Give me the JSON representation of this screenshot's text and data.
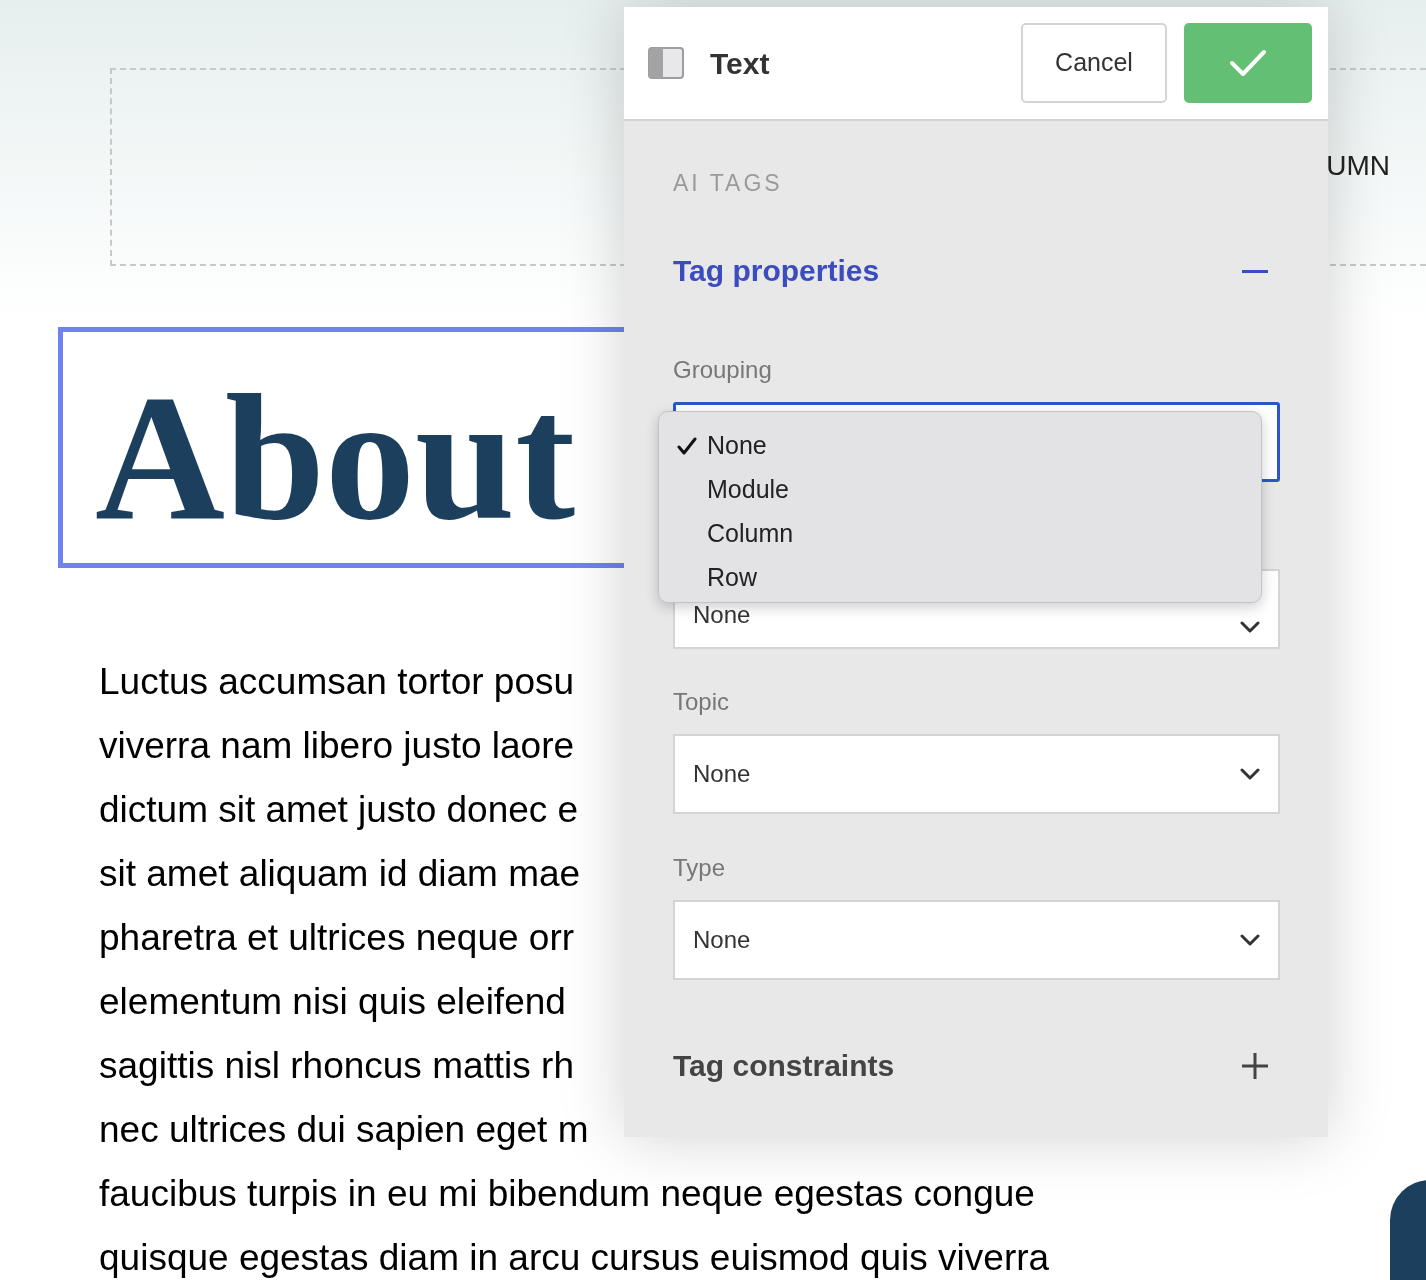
{
  "page": {
    "column_label": "UMN",
    "heading": "About",
    "paragraph_lines": [
      "Luctus accumsan tortor posu",
      "viverra nam libero justo laore",
      "dictum sit amet justo donec e",
      "sit amet aliquam id diam mae",
      "pharetra et ultrices neque orr",
      "elementum nisi quis eleifend",
      "sagittis nisl rhoncus mattis rh",
      "nec ultrices dui sapien eget m",
      "faucibus turpis in eu mi bibendum neque egestas congue",
      "quisque egestas diam in arcu cursus euismod quis viverra"
    ]
  },
  "panel": {
    "title": "Text",
    "cancel": "Cancel",
    "section": "AI TAGS",
    "groups": [
      {
        "title": "Tag properties",
        "expanded": true
      },
      {
        "title": "Tag constraints",
        "expanded": false
      }
    ],
    "fields": [
      {
        "label": "Grouping",
        "focused": true
      },
      {
        "value": "None",
        "focused": false
      },
      {
        "label": "Topic",
        "value": "None",
        "focused": false
      },
      {
        "label": "Type",
        "value": "None",
        "focused": false
      }
    ],
    "menu": {
      "options": [
        {
          "label": "None",
          "selected": true
        },
        {
          "label": "Module",
          "selected": false
        },
        {
          "label": "Column",
          "selected": false
        },
        {
          "label": "Row",
          "selected": false
        }
      ]
    }
  }
}
